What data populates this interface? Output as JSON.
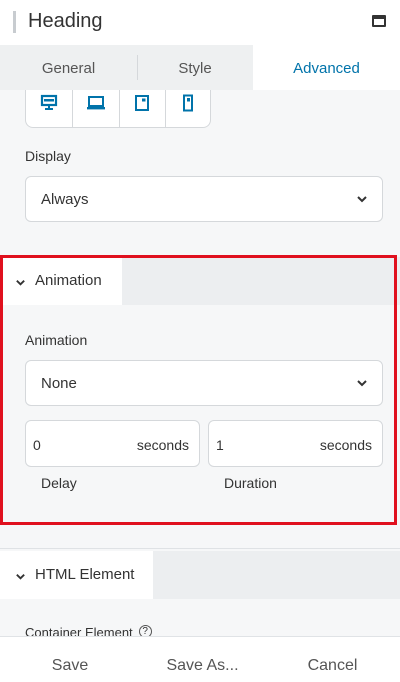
{
  "header": {
    "title": "Heading",
    "window_icon": "window-maximize-icon"
  },
  "tabs": [
    {
      "label": "General",
      "active": false
    },
    {
      "label": "Style",
      "active": false
    },
    {
      "label": "Advanced",
      "active": true
    }
  ],
  "responsive": {
    "devices": [
      "desktop-icon",
      "laptop-icon",
      "tablet-icon",
      "mobile-icon"
    ],
    "accent_color": "#0073aa"
  },
  "display": {
    "label": "Display",
    "value": "Always"
  },
  "animation_section": {
    "title": "Animation",
    "field_label": "Animation",
    "value": "None",
    "delay": {
      "value": "0",
      "unit": "seconds",
      "label": "Delay"
    },
    "duration": {
      "value": "1",
      "unit": "seconds",
      "label": "Duration"
    },
    "highlight_color": "#e0101e"
  },
  "html_section": {
    "title": "HTML Element",
    "container_label": "Container Element",
    "help_glyph": "?"
  },
  "footer": {
    "save": "Save",
    "save_as": "Save As...",
    "cancel": "Cancel"
  }
}
